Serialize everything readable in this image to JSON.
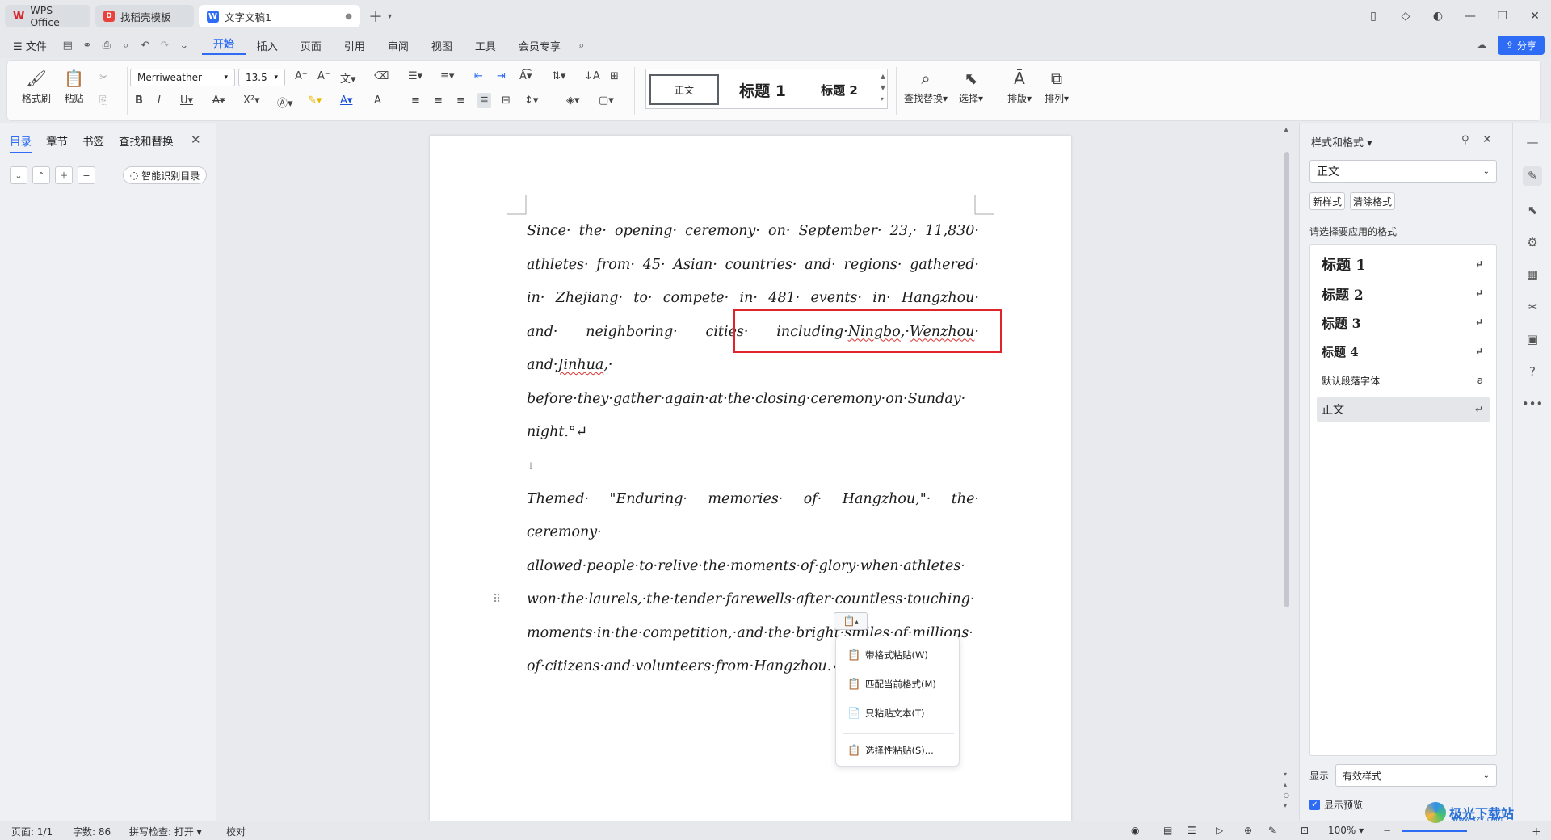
{
  "tabs": [
    {
      "label": "WPS Office"
    },
    {
      "label": "找稻壳模板"
    },
    {
      "label": "文字文稿1"
    }
  ],
  "menu": {
    "file": "文件",
    "items": [
      "开始",
      "插入",
      "页面",
      "引用",
      "审阅",
      "视图",
      "工具",
      "会员专享"
    ],
    "active": "开始",
    "share": "分享"
  },
  "ribbon": {
    "format_painter": "格式刷",
    "paste": "粘贴",
    "font_name": "Merriweather",
    "font_size": "13.5",
    "style_normal": "正文",
    "style_h1": "标题 1",
    "style_h2": "标题 2",
    "find_replace": "查找替换",
    "select": "选择",
    "layout": "排版",
    "arrange": "排列"
  },
  "nav": {
    "tabs": [
      "目录",
      "章节",
      "书签",
      "查找和替换"
    ],
    "active": "目录",
    "smart_toc": "智能识别目录"
  },
  "document": {
    "para1": "Since· the· opening· ceremony· on· September· 23,· 11,830· athletes· from· 45· Asian· countries· and· regions· gathered· in· Zhejiang· to· compete· in· 481· events· in· Hangzhou· and· neighboring· cities· including·",
    "para1_h1": "Ningbo",
    "para1_h1b": ",·",
    "para1_h2": "Wenzhou",
    "para1_h2b": "· and·",
    "para1_h3": "Jinhua",
    "para1_h3b": ",·",
    "para1_end": "before·they·gather·again·at·the·closing·ceremony·on·Sunday· night.°↵",
    "empty_mark": "↓",
    "para2": "Themed· \"Enduring· memories· of· Hangzhou,\"· the· ceremony· allowed·people·to·relive·the·moments·of·glory·when·athletes· won·the·laurels,·the·tender·farewells·after·countless·touching· moments·in·the·competition,·and·the·bright·smiles·of·millions· of·citizens·and·volunteers·from·Hangzhou.↵"
  },
  "paste_menu": [
    {
      "label": "带格式粘贴(W)",
      "icon": "paste-format-icon"
    },
    {
      "label": "匹配当前格式(M)",
      "icon": "paste-match-icon"
    },
    {
      "label": "只粘贴文本(T)",
      "icon": "paste-text-icon"
    },
    {
      "label": "选择性粘贴(S)...",
      "icon": "paste-special-icon"
    }
  ],
  "style_pane": {
    "title": "样式和格式",
    "current": "正文",
    "new_style": "新样式",
    "clear_format": "清除格式",
    "prompt": "请选择要应用的格式",
    "items": [
      {
        "label": "标题 1"
      },
      {
        "label": "标题 2"
      },
      {
        "label": "标题 3"
      },
      {
        "label": "标题 4"
      },
      {
        "label": "默认段落字体"
      },
      {
        "label": "正文"
      }
    ],
    "show_label": "显示",
    "show_value": "有效样式",
    "preview_label": "显示预览"
  },
  "status": {
    "page": "页面: 1/1",
    "words": "字数: 86",
    "spell": "拼写检查: 打开",
    "proof": "校对",
    "zoom": "100%"
  },
  "watermark": {
    "text": "极光下载站",
    "url": "www.xz7.com"
  },
  "colors": {
    "accent": "#2f6cf6",
    "highlight_box": "#e0242c",
    "wps_red": "#d8262c"
  }
}
